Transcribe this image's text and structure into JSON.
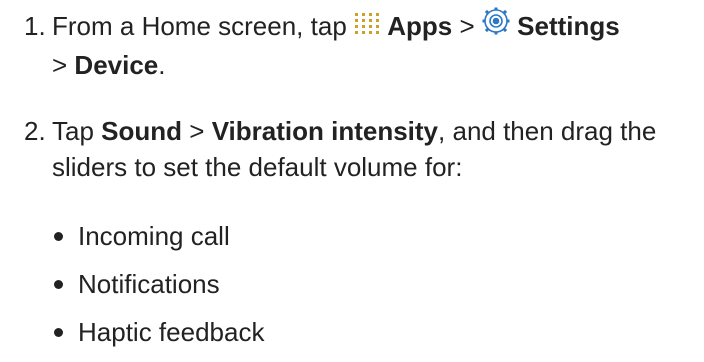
{
  "steps": [
    {
      "number": "1.",
      "intro": "From a Home screen, tap",
      "apps_label": "Apps",
      "sep1": ">",
      "settings_label": "Settings",
      "sep2": ">",
      "device_label": "Device",
      "end": "."
    },
    {
      "number": "2.",
      "intro": "Tap",
      "sound_label": "Sound",
      "sep1": ">",
      "vibration_label": "Vibration intensity",
      "rest": ", and then drag the sliders to set the default volume for:"
    }
  ],
  "bullets": [
    {
      "label": "Incoming call"
    },
    {
      "label": "Notifications"
    },
    {
      "label": "Haptic feedback"
    }
  ],
  "icons": {
    "apps": "apps-grid-icon",
    "settings": "settings-gear-icon"
  },
  "colors": {
    "text": "#222222",
    "apps_dots": "#c9a227",
    "settings_ring": "#2a79c4"
  }
}
